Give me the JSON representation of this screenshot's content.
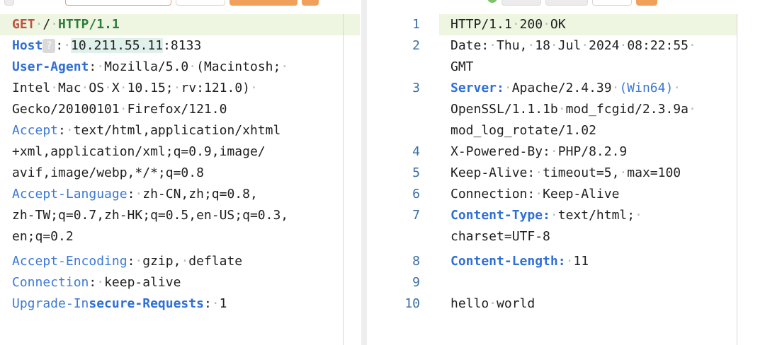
{
  "request": {
    "method": "GET",
    "path": "/",
    "version": "HTTP/1.1",
    "host_label": "Host",
    "host_badge": "?",
    "host_ip": "10.211.55.11",
    "host_port": ":8133",
    "ua_label": "User-Agent",
    "ua_v1": "Mozilla/5.0·(Macintosh;·",
    "ua_v2": "Intel·Mac·OS·X·10.15;·rv:121.0)·",
    "ua_v3": "Gecko/20100101·Firefox/121.0",
    "accept_label": "Accept",
    "accept_v1": "text/html,application/xhtml",
    "accept_v2": "+xml,application/xml;q=0.9,image/",
    "accept_v3": "avif,image/webp,*/*;q=0.8",
    "lang_label": "Accept-Language",
    "lang_v1": "zh-CN,zh;q=0.8,",
    "lang_v2": "zh-TW;q=0.7,zh-HK;q=0.5,en-US;q=0.3,",
    "lang_v3": "en;q=0.2",
    "enc_label": "Accept-Encoding",
    "enc_v": "gzip,·deflate",
    "conn_label": "Connection",
    "conn_v": "keep-alive",
    "uir_label_a": "Upgrade-In",
    "uir_label_b": "secure-Requests",
    "uir_v": "1"
  },
  "response": {
    "line_numbers": [
      "1",
      "2",
      "3",
      "4",
      "5",
      "6",
      "7",
      "8",
      "9",
      "10"
    ],
    "status": "HTTP/1.1·200·OK",
    "date_a": "Date:·Thu,·18·Jul·2024·08:22:55·",
    "date_b": "GMT",
    "server_label": "Server:",
    "server_v1a": "Apache/2.4.39·",
    "server_v1b": "(Win64)",
    "server_v2": "OpenSSL/1.1.1b·mod_fcgid/2.3.9a·",
    "server_v3": "mod_log_rotate/1.02",
    "powered": "X-Powered-By:·PHP/8.2.9",
    "keepalive": "Keep-Alive:·timeout=5,·max=100",
    "connection": "Connection:·Keep-Alive",
    "ctype_label": "Content-Type:",
    "ctype_v1": "text/html;·",
    "ctype_v2": "charset=UTF-8",
    "clen_label": "Content-Length:",
    "clen_v": "11",
    "body": "hello·world"
  },
  "colors": {
    "highlight": "#eef5e0",
    "header_key": "#2f6fd6",
    "method": "#c0513f",
    "version": "#2d7d3a"
  }
}
